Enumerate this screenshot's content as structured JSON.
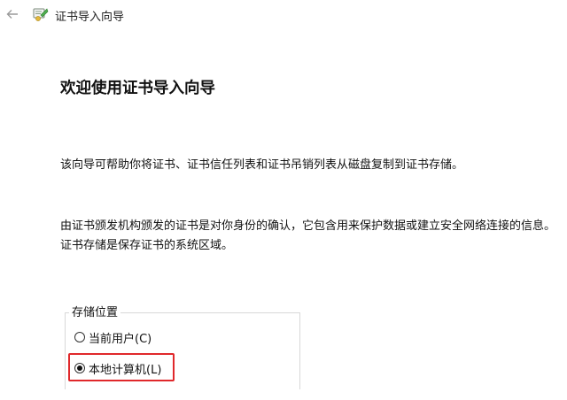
{
  "window": {
    "title": "证书导入向导",
    "back_icon": "arrow-left-icon",
    "app_icon": "certificate-icon"
  },
  "main": {
    "heading": "欢迎使用证书导入向导",
    "paragraph1": "该向导可帮助你将证书、证书信任列表和证书吊销列表从磁盘复制到证书存储。",
    "paragraph2": "由证书颁发机构颁发的证书是对你身份的确认，它包含用来保护数据或建立安全网络连接的信息。证书存储是保存证书的系统区域。"
  },
  "store_location": {
    "legend": "存储位置",
    "options": [
      {
        "label": "当前用户(C)",
        "selected": false
      },
      {
        "label": "本地计算机(L)",
        "selected": true
      }
    ]
  },
  "colors": {
    "highlight": "#e0282b",
    "text": "#111111",
    "background": "#ffffff"
  }
}
